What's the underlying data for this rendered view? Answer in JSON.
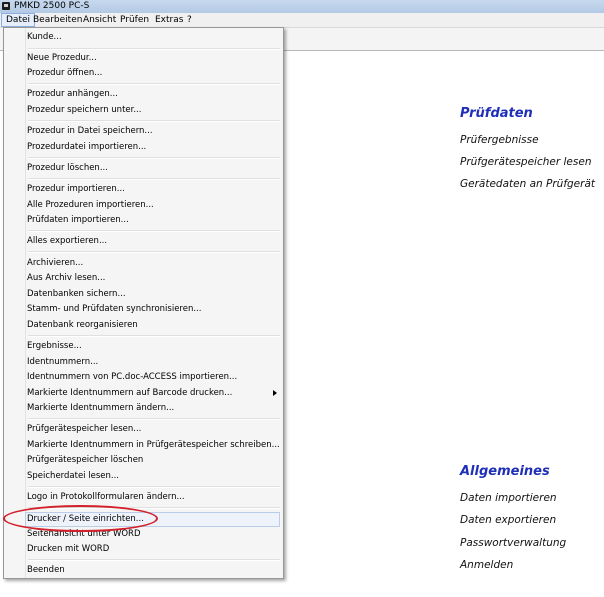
{
  "window": {
    "title": "PMKD 2500 PC-S"
  },
  "menubar": {
    "items": [
      "Datei",
      "Bearbeiten",
      "Ansicht",
      "Prüfen",
      "Extras",
      "?"
    ]
  },
  "dropdown": {
    "items": [
      "Kunde...",
      "Neue Prozedur...",
      "Prozedur öffnen...",
      "Prozedur anhängen...",
      "Prozedur speichern unter...",
      "Prozedur in Datei speichern...",
      "Prozedurdatei importieren...",
      "Prozedur löschen...",
      "Prozedur importieren...",
      "Alle Prozeduren importieren...",
      "Prüfdaten importieren...",
      "Alles exportieren...",
      "Archivieren...",
      "Aus Archiv lesen...",
      "Datenbanken sichern...",
      "Stamm- und Prüfdaten synchronisieren...",
      "Datenbank reorganisieren",
      "Ergebnisse...",
      "Identnummern...",
      "Identnummern von PC.doc-ACCESS importieren...",
      "Markierte Identnummern auf Barcode drucken...",
      "Markierte Identnummern ändern...",
      "Prüfgerätespeicher lesen...",
      "Markierte Identnummern in Prüfgerätespeicher schreiben...",
      "Prüfgerätespeicher löschen",
      "Speicherdatei lesen...",
      "Logo in Protokollformularen ändern...",
      "Drucker / Seite einrichten...",
      "Seitenansicht unter WORD",
      "Drucken mit WORD",
      "Beenden"
    ]
  },
  "pruefdaten": {
    "title": "Prüfdaten",
    "links": [
      "Prüfergebnisse",
      "Prüfgerätespeicher lesen",
      "Gerätedaten an Prüfgerät"
    ]
  },
  "allgemeines": {
    "title": "Allgemeines",
    "links": [
      "Daten importieren",
      "Daten exportieren",
      "Passwortverwaltung",
      "Anmelden"
    ]
  },
  "colors": {
    "section_title": "#1f2fb8",
    "annotation": "#d3202a"
  }
}
